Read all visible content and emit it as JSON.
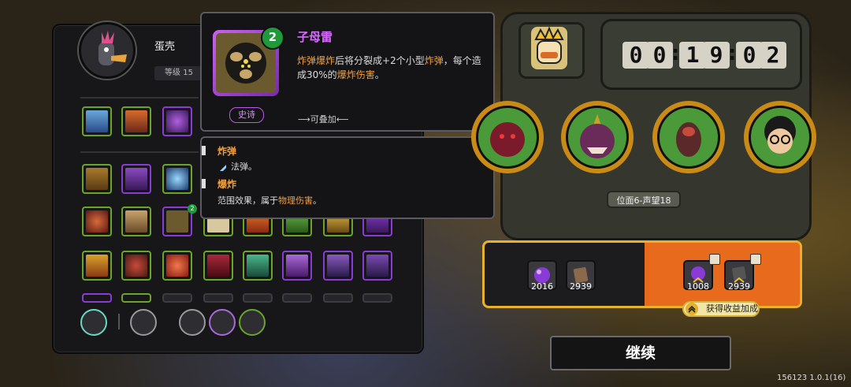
{
  "character": {
    "name": "蛋壳",
    "level": "等级 15"
  },
  "tooltip": {
    "title": "子母雷",
    "stack_count": "2",
    "desc_parts": [
      "炸弹爆炸",
      "后将分裂成+2个小型",
      "炸弹",
      "，每个造成30%的",
      "爆炸伤害",
      "。"
    ],
    "rarity": "史诗",
    "stackable": "⟶可叠加⟵",
    "keywords": [
      {
        "title": "炸弹",
        "desc": "法弹。"
      },
      {
        "title": "爆炸",
        "desc_parts": [
          "范围效果，属于",
          "物理伤害",
          "。"
        ]
      }
    ]
  },
  "timer": {
    "digits": [
      "0",
      "0",
      "1",
      "9",
      "0",
      "2"
    ]
  },
  "progress": {
    "position_label": "位面6-声望18"
  },
  "rewards": {
    "base": [
      {
        "icon": "purple-orb-icon",
        "value": "2016"
      },
      {
        "icon": "brown-card-icon",
        "value": "2939"
      }
    ],
    "bonus": [
      {
        "icon": "purple-orb-icon",
        "value": "1008"
      },
      {
        "icon": "black-card-icon",
        "value": "2939"
      }
    ],
    "bonus_label": "获得收益加成"
  },
  "actions": {
    "continue_label": "继续"
  },
  "footer": {
    "version": "156123 1.0.1(16)"
  },
  "colors": {
    "accent_gold": "#e6b22c",
    "reward_orange": "#e86a1c",
    "epic_purple": "#d86aff",
    "highlight_orange": "#f0a040"
  }
}
